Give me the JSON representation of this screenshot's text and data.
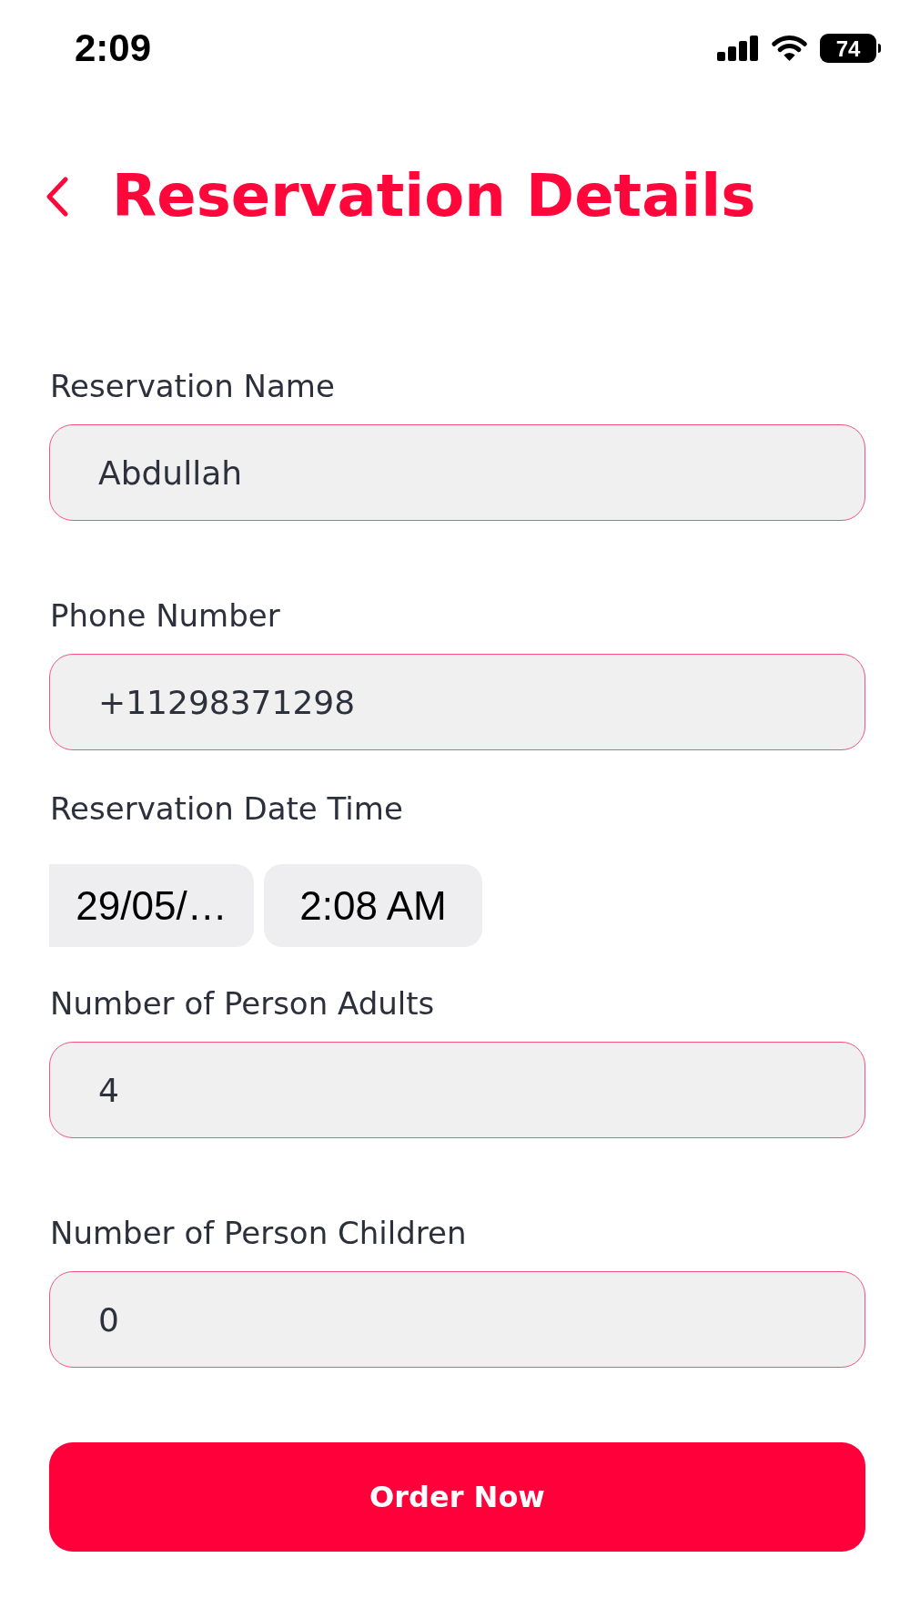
{
  "status_bar": {
    "time": "2:09",
    "battery": "74"
  },
  "header": {
    "title": "Reservation Details"
  },
  "fields": [
    {
      "kind": "text",
      "label": "Reservation Name",
      "value": "Abdullah"
    },
    {
      "kind": "text",
      "label": "Phone Number",
      "value": "+11298371298"
    },
    {
      "kind": "datetime",
      "label": "Reservation Date Time",
      "date": "29/05/…",
      "time": "2:08 AM"
    },
    {
      "kind": "text",
      "label": "Number of Person Adults",
      "value": "4"
    },
    {
      "kind": "text",
      "label": "Number of Person Children",
      "value": "0"
    }
  ],
  "submit_button": {
    "label": "Order Now"
  }
}
